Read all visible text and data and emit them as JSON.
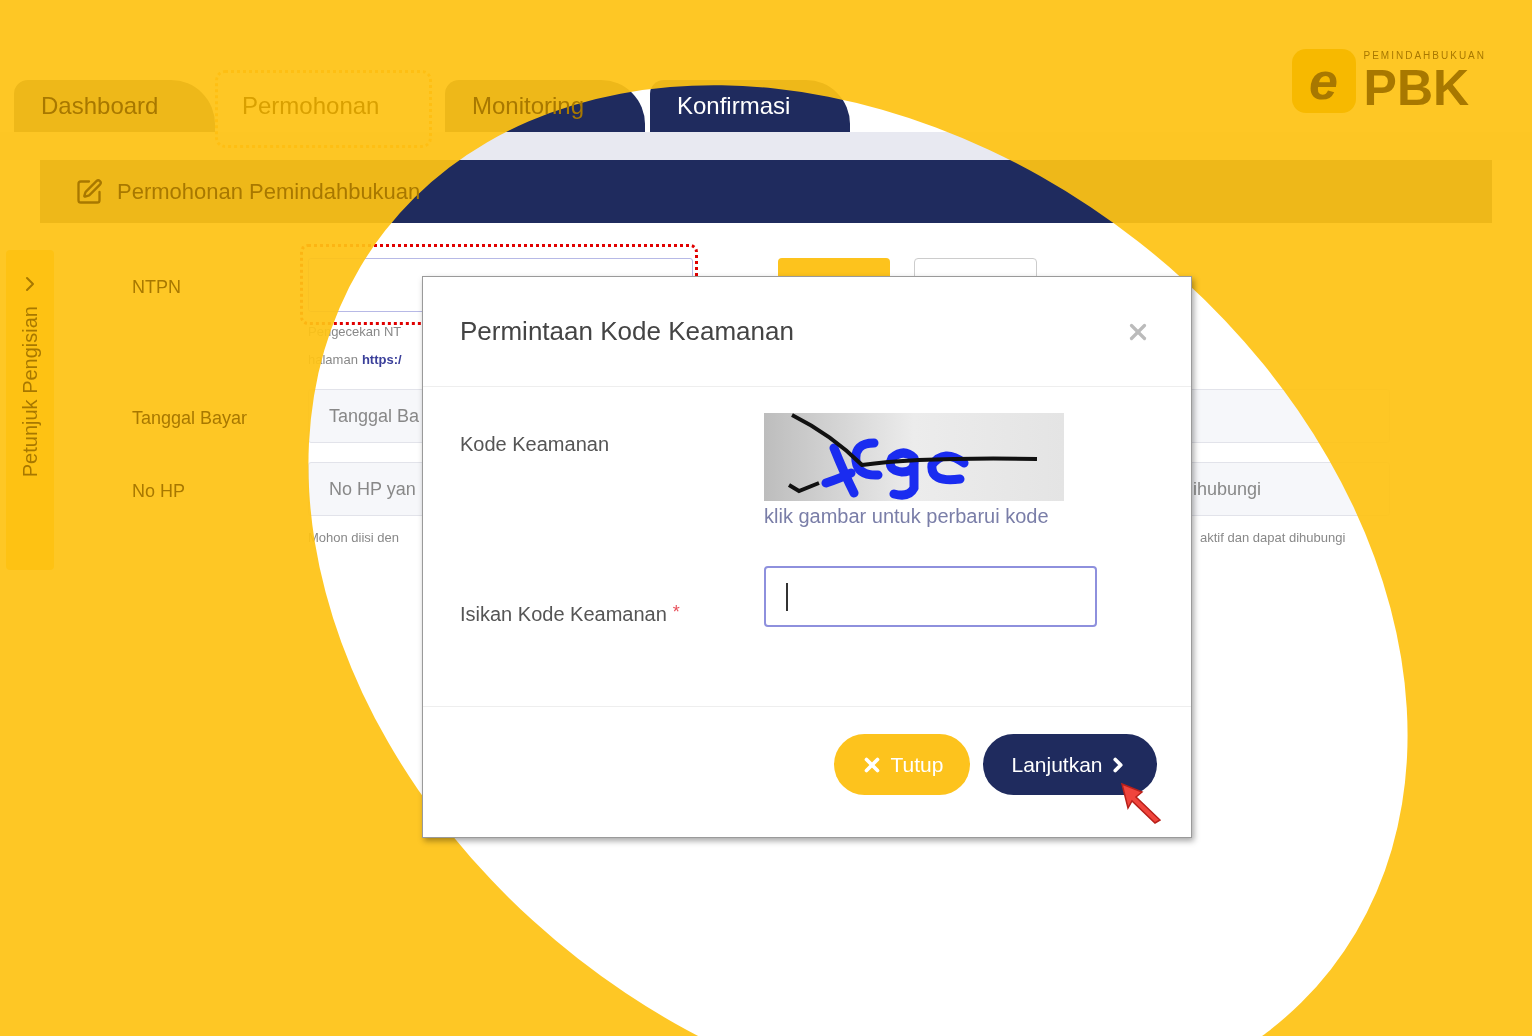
{
  "logo": {
    "mark": "e",
    "tagline": "PEMINDAHBUKUAN",
    "name": "PBK"
  },
  "tabs": [
    {
      "label": "Dashboard",
      "selected": false
    },
    {
      "label": "Permohonan",
      "selected": true
    },
    {
      "label": "Monitoring",
      "selected": false
    },
    {
      "label": "Konfirmasi",
      "selected": false
    }
  ],
  "panel": {
    "title": "Permohonan Pemindahbukuan"
  },
  "sidebar_tab": {
    "label": "Petunjuk Pengisian"
  },
  "form": {
    "ntpn": {
      "label": "NTPN",
      "help_line_1": "Pengecekan NT",
      "help_line_2": "halaman",
      "help_link": "https:/"
    },
    "tanggal": {
      "label": "Tanggal Bayar",
      "placeholder": "Tanggal Ba"
    },
    "hp": {
      "label": "No HP",
      "placeholder": "No HP yan",
      "placeholder_tail": "ihubungi",
      "help": "Mohon diisi den",
      "help_tail": "aktif dan dapat dihubungi"
    }
  },
  "modal": {
    "title": "Permintaan Kode Keamanan",
    "captcha_label": "Kode Keamanan",
    "captcha_hint": "klik gambar untuk perbarui kode",
    "input_label": "Isikan Kode Keamanan",
    "required_mark": "*",
    "input_focused": true,
    "buttons": [
      {
        "label": "Tutup",
        "kind": "close"
      },
      {
        "label": "Lanjutkan",
        "kind": "next"
      }
    ]
  }
}
